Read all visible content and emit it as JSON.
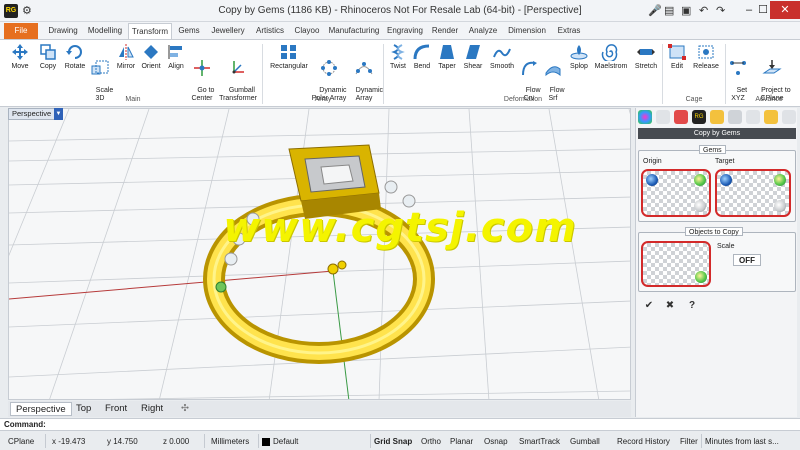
{
  "title": "Copy by Gems (1186 KB) - Rhinoceros Not For Resale Lab (64-bit) - [Perspective]",
  "app_icon_label": "RG",
  "window": {
    "minimize": "–",
    "maximize": "☐",
    "close": "✕"
  },
  "quick_access": [
    "⚙",
    "🎤",
    "▤",
    "▣",
    "↶",
    "↷"
  ],
  "tabs": [
    "File",
    "Drawing",
    "Modelling",
    "Transform",
    "Gems",
    "Jewellery",
    "Artistics",
    "Clayoo",
    "Manufacturing",
    "Engraving",
    "Render",
    "Analyze",
    "Dimension",
    "Extras"
  ],
  "active_tab": "Transform",
  "ribbon": {
    "main": [
      {
        "label": "Move",
        "icon": "move-icon"
      },
      {
        "label": "Copy",
        "icon": "copy-icon"
      },
      {
        "label": "Rotate",
        "icon": "rotate-icon"
      },
      {
        "label": "Scale\n3D",
        "icon": "scale-3d-icon"
      },
      {
        "label": "Mirror",
        "icon": "mirror-icon"
      },
      {
        "label": "Orient",
        "icon": "orient-icon"
      },
      {
        "label": "Align",
        "icon": "align-icon"
      },
      {
        "label": "Go to\nCenter",
        "icon": "go-to-center-icon"
      },
      {
        "label": "Gumball\nTransformer",
        "icon": "gumball-icon"
      }
    ],
    "array": [
      {
        "label": "Rectangular",
        "icon": "rectangular-array-icon"
      },
      {
        "label": "Dynamic\nPolar Array",
        "icon": "polar-array-icon"
      },
      {
        "label": "Dynamic\nArray",
        "icon": "dynamic-array-icon"
      }
    ],
    "deformation": [
      {
        "label": "Twist",
        "icon": "twist-icon"
      },
      {
        "label": "Bend",
        "icon": "bend-icon"
      },
      {
        "label": "Taper",
        "icon": "taper-icon"
      },
      {
        "label": "Shear",
        "icon": "shear-icon"
      },
      {
        "label": "Smooth",
        "icon": "smooth-icon"
      },
      {
        "label": "Flow\nCrv",
        "icon": "flow-curve-icon"
      },
      {
        "label": "Flow\nSrf",
        "icon": "flow-surface-icon"
      },
      {
        "label": "Splop",
        "icon": "splop-icon"
      },
      {
        "label": "Maelstrom",
        "icon": "maelstrom-icon"
      },
      {
        "label": "Stretch",
        "icon": "stretch-icon"
      }
    ],
    "cage": [
      {
        "label": "Edit",
        "icon": "cage-edit-icon"
      },
      {
        "label": "Release",
        "icon": "cage-release-icon"
      }
    ],
    "advance": [
      {
        "label": "Set\nXYZ",
        "icon": "set-xyz-icon"
      },
      {
        "label": "Project to\nCPlane",
        "icon": "project-cplane-icon"
      }
    ],
    "group_labels": {
      "main": "Main",
      "array": "Array",
      "deformation": "Deformation",
      "cage": "Cage",
      "advance": "Advance"
    }
  },
  "viewport": {
    "label": "Perspective",
    "dropdown": "▼"
  },
  "watermark": "www.cgtsj.com",
  "view_tabs": [
    "Perspective",
    "Top",
    "Front",
    "Right"
  ],
  "add_view": "✣",
  "command": {
    "label": "Command:"
  },
  "status": {
    "cplane": "CPlane",
    "x": "x -19.473",
    "y": "y 14.750",
    "z": "z 0.000",
    "units": "Millimeters",
    "layer": "Default",
    "toggles": [
      "Grid Snap",
      "Ortho",
      "Planar",
      "Osnap",
      "SmartTrack",
      "Gumball",
      "Record History",
      "Filter"
    ],
    "bold_toggles": [
      "Grid Snap"
    ],
    "autosave": "Minutes from last s..."
  },
  "panel": {
    "title": "Copy by Gems",
    "gems_group": "Gems",
    "origin_label": "Origin",
    "target_label": "Target",
    "objects_group": "Objects to Copy",
    "scale_label": "Scale",
    "scale_value": "OFF",
    "ok": "✔",
    "cancel": "✖",
    "help": "?"
  },
  "colors": {
    "file_tab": "#e66f1f",
    "gold": "#e8c600",
    "panel_head": "#474b51",
    "accent_red": "#d32a2a"
  }
}
